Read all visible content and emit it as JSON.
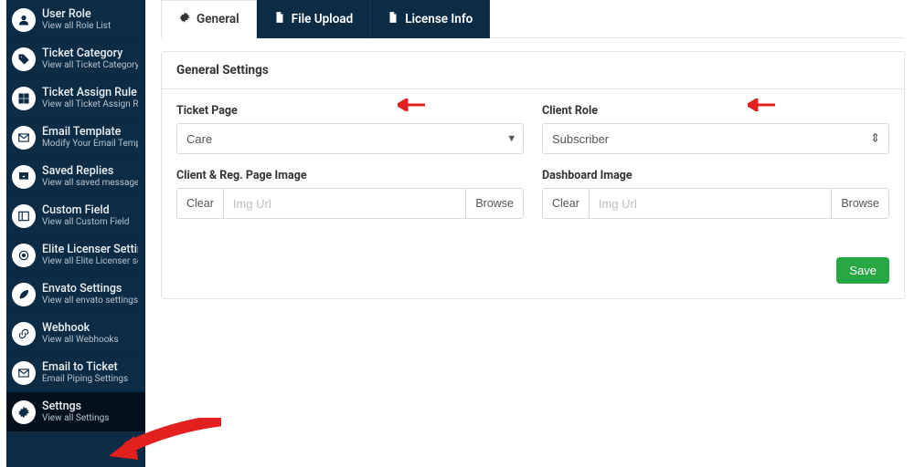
{
  "sidebar": {
    "items": [
      {
        "title": "User Role",
        "sub": "View all Role List",
        "icon": "user-icon",
        "active": false
      },
      {
        "title": "Ticket Category",
        "sub": "View all Ticket Category",
        "icon": "tag-icon",
        "active": false
      },
      {
        "title": "Ticket Assign Rule",
        "sub": "View all Ticket Assign Rule",
        "icon": "grid-icon",
        "active": false
      },
      {
        "title": "Email Template",
        "sub": "Modify Your Email Template",
        "icon": "mail-icon",
        "active": false
      },
      {
        "title": "Saved Replies",
        "sub": "View all saved message",
        "icon": "inbox-icon",
        "active": false
      },
      {
        "title": "Custom Field",
        "sub": "View all Custom Field",
        "icon": "panel-icon",
        "active": false
      },
      {
        "title": "Elite Licenser Setting",
        "sub": "View all Elite Licenser settings",
        "icon": "badge-icon",
        "active": false
      },
      {
        "title": "Envato Settings",
        "sub": "View all envato settings",
        "icon": "leaf-icon",
        "active": false
      },
      {
        "title": "Webhook",
        "sub": "View all Webhooks",
        "icon": "link-icon",
        "active": false
      },
      {
        "title": "Email to Ticket",
        "sub": "Email Piping Settings",
        "icon": "mail-icon",
        "active": false
      },
      {
        "title": "Settngs",
        "sub": "View all Settings",
        "icon": "gear-icon",
        "active": true
      }
    ]
  },
  "tabs": [
    {
      "label": "General",
      "icon": "gear-icon",
      "active": true
    },
    {
      "label": "File Upload",
      "icon": "file-icon",
      "active": false
    },
    {
      "label": "License Info",
      "icon": "file-icon",
      "active": false
    }
  ],
  "panel": {
    "header": "General Settings",
    "ticket_page": {
      "label": "Ticket Page",
      "value": "Care"
    },
    "client_role": {
      "label": "Client Role",
      "value": "Subscriber"
    },
    "client_reg_image": {
      "label": "Client & Reg. Page Image",
      "clear": "Clear",
      "placeholder": "Img Url",
      "browse": "Browse"
    },
    "dashboard_image": {
      "label": "Dashboard Image",
      "clear": "Clear",
      "placeholder": "Img Url",
      "browse": "Browse"
    },
    "save": "Save"
  },
  "colors": {
    "accent_arrow": "#e1201f",
    "sidebar_bg": "#0c2b45",
    "save_btn": "#28a745"
  }
}
